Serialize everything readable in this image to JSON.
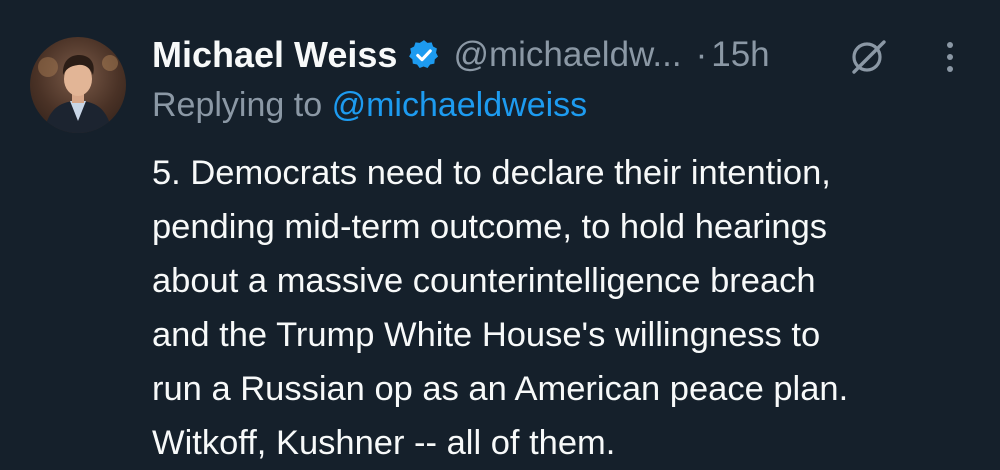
{
  "tweet": {
    "author_name": "Michael Weiss",
    "handle": "@michaeldw...",
    "separator": "·",
    "timestamp": "15h",
    "replying_to_prefix": "Replying to",
    "replying_to_handle": "@michaeldweiss",
    "text_lines": [
      "5. Democrats need to declare their intention,",
      "pending mid-term outcome, to hold hearings",
      "about a massive counterintelligence breach",
      "and the Trump White House's willingness to",
      "run a Russian op as an American peace plan.",
      "Witkoff, Kushner -- all of them."
    ]
  },
  "icons": {
    "verified": "verified-badge-icon",
    "grok": "grok-icon",
    "more": "more-options-icon"
  },
  "colors": {
    "background": "#15202b",
    "primary_text": "#f7f9f9",
    "secondary_text": "#8b98a5",
    "accent": "#1d9bf0"
  }
}
